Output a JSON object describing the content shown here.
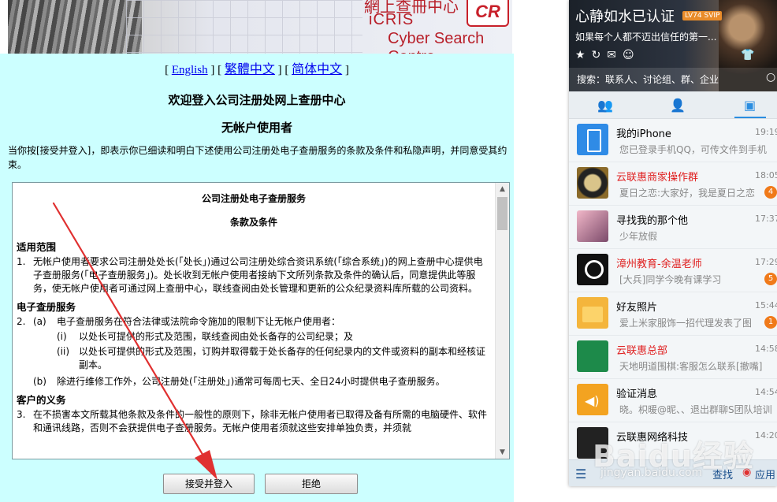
{
  "banner": {
    "title_cn": "網上查冊中心",
    "icris": "iCRIS",
    "cyber": "Cyber Search Centre",
    "logo": "CR"
  },
  "lang": {
    "open1": "[",
    "english": "English",
    "sep1": "] [",
    "trad": "繁體中文",
    "sep2": "] [",
    "simp": "简体中文",
    "close": "]"
  },
  "heading": "欢迎登入公司注册处网上查册中心",
  "subheading": "无帐户使用者",
  "intro": "当你按[接受并登入]，即表示你已细读和明白下述使用公司注册处电子查册服务的条款及条件和私隐声明，并同意受其约束。",
  "terms": {
    "title": "公司注册处电子查册服务",
    "subtitle": "条款及条件",
    "sec1_title": "适用范围",
    "item1_num": "1.",
    "item1_text": "无帐户使用者要求公司注册处处长(「处长」)通过公司注册处综合资讯系统(「综合系统」)的网上查册中心提供电子查册服务(「电子查册服务」)。处长收到无帐户使用者接纳下文所列条款及条件的确认后，同意提供此等服务，使无帐户使用者可通过网上查册中心，联线查阅由处长管理和更新的公众纪录资料库所载的公司资料。",
    "sec2_title": "电子查册服务",
    "item2_num": "2.",
    "item2a_num": "(a)",
    "item2a_text": "电子查册服务在符合法律或法院命令施加的限制下让无帐户使用者：",
    "item2ai_num": "(i)",
    "item2ai_text": "以处长可提供的形式及范围，联线查阅由处长备存的公司纪录；及",
    "item2aii_num": "(ii)",
    "item2aii_text": "以处长可提供的形式及范围，订购并取得载于处长备存的任何纪录内的文件或资料的副本和经核证副本。",
    "item2b_num": "(b)",
    "item2b_text": "除进行维修工作外，公司注册处(「注册处」)通常可每周七天、全日24小时提供电子查册服务。",
    "sec3_title": "客户的义务",
    "item3_num": "3.",
    "item3_text": "在不损害本文所载其他条款及条件的一般性的原则下，除非无帐户使用者已取得及备有所需的电脑硬件、软件和通讯线路，否则不会获提供电子查册服务。无帐户使用者须就这些安排单独负责，并须就"
  },
  "buttons": {
    "accept": "接受并登入",
    "reject": "拒绝"
  },
  "qq": {
    "name": "心静如水已认证",
    "badge": "LV74 SVIP",
    "signature": "如果每个人都不迈出信任的第一...",
    "search_placeholder": "搜索：联系人、讨论组、群、企业",
    "items": [
      {
        "name": "我的iPhone",
        "msg": "您已登录手机QQ，可传文件到手机",
        "time": "19:19",
        "count": "",
        "red": false
      },
      {
        "name": "云联惠商家操作群",
        "msg": "夏日之恋:大家好，我是夏日之恋",
        "time": "18:05",
        "count": "4",
        "red": true
      },
      {
        "name": "寻找我的那个他",
        "msg": "少年放假",
        "time": "17:37",
        "count": "",
        "red": false
      },
      {
        "name": "漳州教育-余温老师",
        "msg": "[大兵]同学今晚有课学习",
        "time": "17:29",
        "count": "5",
        "red": true
      },
      {
        "name": "好友照片",
        "msg": "爱上米家服饰一招代理发表了图",
        "time": "15:44",
        "count": "1",
        "red": false
      },
      {
        "name": "云联惠总部",
        "msg": "天地明道围棋:客服怎么联系[撤嘴]",
        "time": "14:58",
        "count": "",
        "red": true
      },
      {
        "name": "验证消息",
        "msg": "晓。枳暖@昵、、退出群聊S团队培训",
        "time": "14:54",
        "count": "",
        "red": false
      },
      {
        "name": "云联惠网络科技",
        "msg": "",
        "time": "14:20",
        "count": "",
        "red": false
      }
    ],
    "bottom_find": "查找",
    "bottom_app": "应用"
  },
  "watermark": {
    "main": "Baidu经验",
    "sub": "jingyan.baidu.com"
  },
  "colors": {
    "page_bg": "#ccffff",
    "link": "#0000ee",
    "arrow": "#e03030",
    "qq_accent": "#2b8de0"
  }
}
